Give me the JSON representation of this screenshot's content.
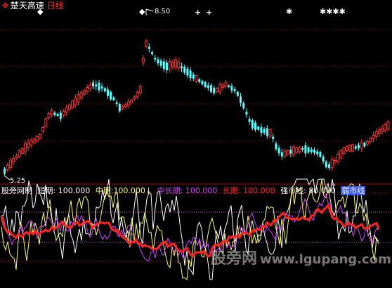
{
  "title_bar": {
    "stock_name": "楚天高速",
    "period": "日线",
    "logo_icon": "diamond-logo-icon"
  },
  "price_panel": {
    "high_label": "8.50",
    "low_label": "5.25",
    "signal_marks": [
      "◆",
      "◆",
      "+",
      "+",
      "✱",
      "✱✱✱✱"
    ],
    "colors": {
      "up": "#ff3333",
      "down": "#54ffff",
      "grid": "#7a0000"
    }
  },
  "indicator_bar": {
    "name": "股旁网制",
    "items": [
      {
        "label": "短期:",
        "value": "100.000",
        "color": "#ffffff"
      },
      {
        "label": "中期:",
        "value": "100.000↓",
        "color": "#ffff66"
      },
      {
        "label": "中长期:",
        "value": "100.000",
        "color": "#cc44ff"
      },
      {
        "label": "长期:",
        "value": "100.000",
        "color": "#ff2222"
      },
      {
        "label": "强市线:",
        "value": "80.000",
        "color": "#ffffff"
      }
    ],
    "weak_line_label": "弱市线",
    "weak_line_color": "#3355ff"
  },
  "watermark": {
    "text": "股旁网",
    "url": "www.lgupang.com"
  }
}
